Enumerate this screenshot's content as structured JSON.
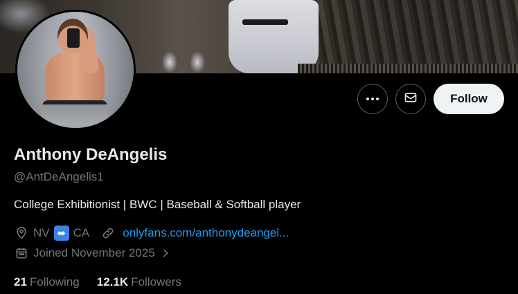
{
  "profile": {
    "name": "Anthony DeAngelis",
    "handle": "@AntDeAngelis1",
    "bio": "College Exhibitionist | BWC | Baseball & Softball player",
    "location_from": "NV",
    "location_to": "CA",
    "location_connector_icon": "left-right-arrow-emoji",
    "link": "onlyfans.com/anthonydeangel...",
    "joined": "Joined November 2025"
  },
  "actions": {
    "more_icon": "more-icon",
    "message_icon": "mail-icon",
    "follow_label": "Follow"
  },
  "stats": {
    "following_count": "21",
    "following_label": "Following",
    "followers_count": "12.1K",
    "followers_label": "Followers"
  },
  "colors": {
    "background": "#000000",
    "text_primary": "#e7e9ea",
    "text_secondary": "#71767b",
    "link": "#1d9bf0",
    "follow_button_bg": "#eff3f4"
  }
}
